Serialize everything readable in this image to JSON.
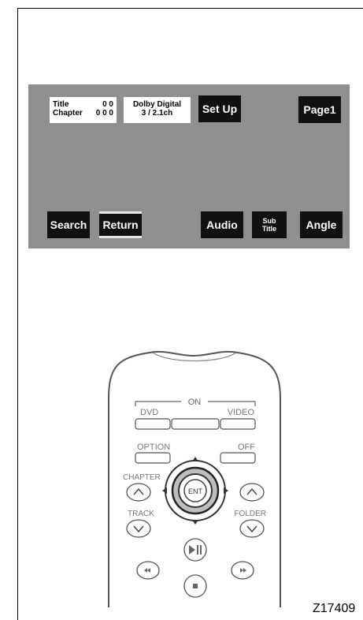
{
  "dvd_screen": {
    "title_label": "Title",
    "title_value": "0 0",
    "chapter_label": "Chapter",
    "chapter_value": "0 0 0",
    "audio_format": "Dolby Digital",
    "audio_channels": "3 / 2.1ch",
    "buttons": {
      "setup": "Set Up",
      "page": "Page1",
      "search": "Search",
      "return": "Return",
      "audio": "Audio",
      "subtitle_line1": "Sub",
      "subtitle_line2": "Title",
      "angle": "Angle"
    }
  },
  "remote": {
    "on_label": "ON",
    "dvd_label": "DVD",
    "video_label": "VIDEO",
    "option_label": "OPTION",
    "off_label": "OFF",
    "chapter_label": "CHAPTER",
    "track_label": "TRACK",
    "folder_label": "FOLDER",
    "ent_label": "ENT"
  },
  "figure_id": "Z17409"
}
